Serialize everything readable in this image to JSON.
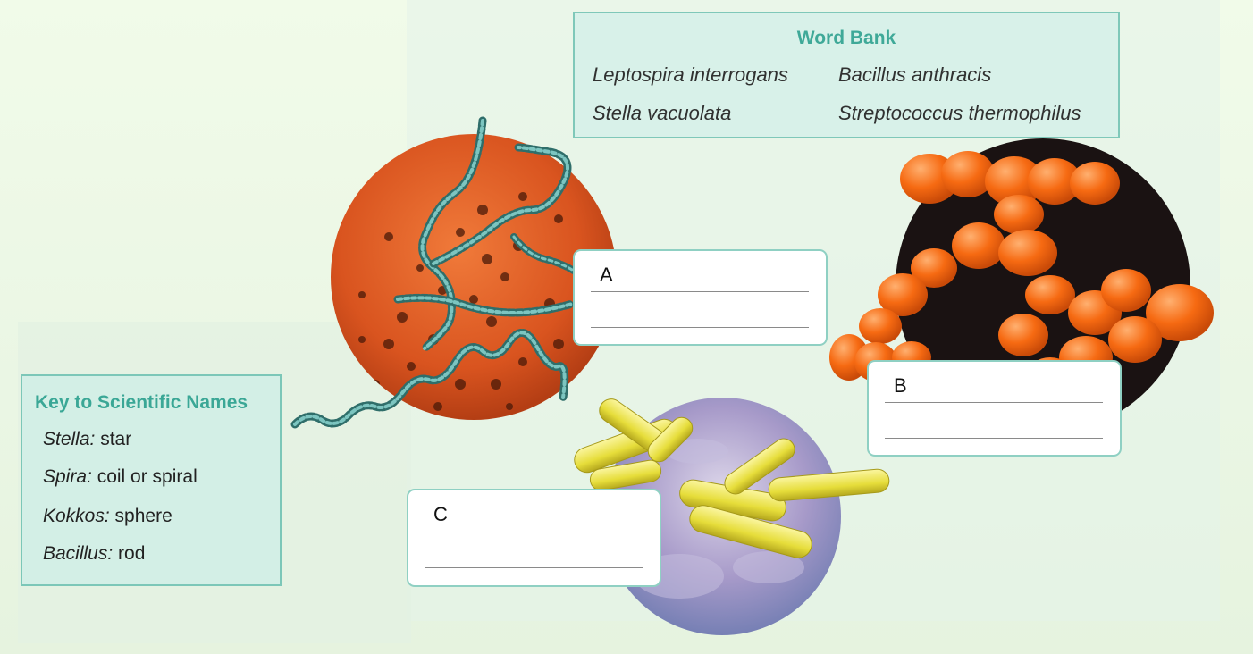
{
  "word_bank": {
    "title": "Word Bank",
    "terms": [
      "Leptospira interrogans",
      "Bacillus anthracis",
      "Stella vacuolata",
      "Streptococcus thermophilus"
    ]
  },
  "key": {
    "title": "Key to Scientific Names",
    "items": [
      {
        "term": "Stella:",
        "meaning": " star"
      },
      {
        "term": "Spira:",
        "meaning": " coil or spiral"
      },
      {
        "term": "Kokkos:",
        "meaning": " sphere"
      },
      {
        "term": "Bacillus:",
        "meaning": " rod"
      }
    ]
  },
  "labels": {
    "a": "A",
    "b": "B",
    "c": "C"
  },
  "colors": {
    "accent": "#3aa796",
    "box_border": "#7cc7b8",
    "spirochete_bg": "#d9541f",
    "cocci": "#f66a12",
    "bacilli": "#e6dd3a",
    "bacilli_bg": "#a79ac9"
  }
}
